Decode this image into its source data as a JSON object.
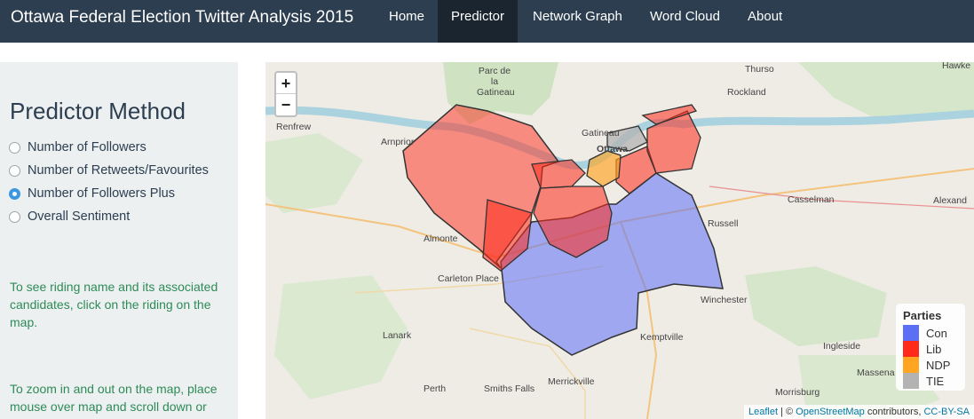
{
  "navbar": {
    "brand": "Ottawa Federal Election Twitter Analysis 2015",
    "items": [
      {
        "label": "Home",
        "active": false
      },
      {
        "label": "Predictor",
        "active": true
      },
      {
        "label": "Network Graph",
        "active": false
      },
      {
        "label": "Word Cloud",
        "active": false
      },
      {
        "label": "About",
        "active": false
      }
    ]
  },
  "sidebar": {
    "title": "Predictor Method",
    "options": [
      {
        "label": "Number of Followers",
        "checked": false
      },
      {
        "label": "Number of Retweets/Favourites",
        "checked": false
      },
      {
        "label": "Number of Followers Plus",
        "checked": true
      },
      {
        "label": "Overall Sentiment",
        "checked": false
      }
    ],
    "help1": "To see riding name and its associated candidates, click on the riding on the map.",
    "help2": "To zoom in and out on the map, place mouse over map and scroll down or"
  },
  "map": {
    "zoom_in": "+",
    "zoom_out": "−",
    "place_labels": [
      "Thurso",
      "Hawke",
      "Parc de la Gatineau",
      "Rockland",
      "Renfrew",
      "Gatineau",
      "Ottawa",
      "Arnprior",
      "Casselman",
      "Alexand",
      "Russell",
      "Almonte",
      "Carleton Place",
      "Winchester",
      "Lanark",
      "Kemptville",
      "Ingleside",
      "Massena",
      "Perth",
      "Smiths Falls",
      "Merrickville",
      "Morrisburg"
    ],
    "legend": {
      "title": "Parties",
      "items": [
        {
          "label": "Con",
          "color": "#5b6ff5"
        },
        {
          "label": "Lib",
          "color": "#ff2a1a"
        },
        {
          "label": "NDP",
          "color": "#ffa520"
        },
        {
          "label": "TIE",
          "color": "#b3b3b3"
        }
      ]
    },
    "attribution": {
      "leaflet": "Leaflet",
      "sep": " | © ",
      "osm": "OpenStreetMap",
      "contrib": " contributors, ",
      "license": "CC-BY-SA"
    }
  }
}
